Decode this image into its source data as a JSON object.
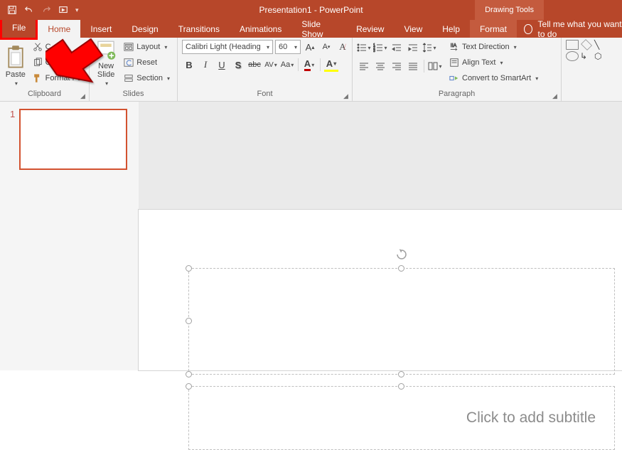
{
  "title": "Presentation1 - PowerPoint",
  "context_tab": "Drawing Tools",
  "tabs": {
    "file": "File",
    "home": "Home",
    "insert": "Insert",
    "design": "Design",
    "transitions": "Transitions",
    "animations": "Animations",
    "slideshow": "Slide Show",
    "review": "Review",
    "view": "View",
    "help": "Help",
    "format": "Format"
  },
  "tell_me": "Tell me what you want to do",
  "ribbon": {
    "clipboard": {
      "label": "Clipboard",
      "paste": "Paste",
      "cut": "C",
      "copy": "C",
      "format_painter": "Format Pa"
    },
    "slides": {
      "label": "Slides",
      "new_slide": "New\nSlide",
      "layout": "Layout",
      "reset": "Reset",
      "section": "Section"
    },
    "font": {
      "label": "Font",
      "name": "Calibri Light (Heading",
      "size": "60",
      "bold": "B",
      "italic": "I",
      "underline": "U",
      "strike": "S",
      "shadow": "S",
      "abc": "abc",
      "av": "AV",
      "aa": "Aa",
      "grow": "A",
      "shrink": "A",
      "clear": "A"
    },
    "paragraph": {
      "label": "Paragraph",
      "text_direction": "Text Direction",
      "align_text": "Align Text",
      "smartart": "Convert to SmartArt"
    },
    "drawing": {
      "label": ""
    }
  },
  "slide": {
    "number": "1",
    "subtitle_placeholder": "Click to add subtitle"
  }
}
